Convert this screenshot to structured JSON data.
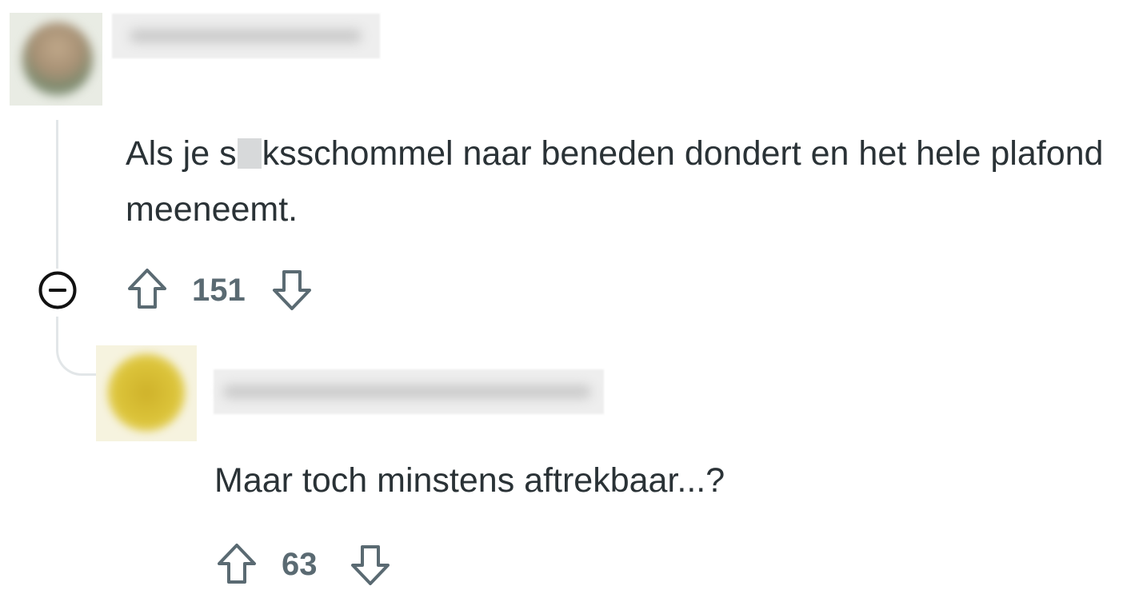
{
  "comments": [
    {
      "text_before_censor": "Als je s",
      "text_after_censor": "ksschommel naar beneden dondert en het hele plafond meeneemt.",
      "score": "151",
      "icons": {
        "upvote": "arrow-up-outline-icon",
        "downvote": "arrow-down-outline-icon",
        "collapse": "minus-circle-icon"
      }
    },
    {
      "text": "Maar toch minstens aftrekbaar...?",
      "score": "63",
      "icons": {
        "upvote": "arrow-up-outline-icon",
        "downvote": "arrow-down-outline-icon"
      }
    }
  ],
  "colors": {
    "text": "#2a3236",
    "meta": "#5a6a72",
    "thread_line": "#e2e6e8",
    "icon": "#5a6a72"
  }
}
